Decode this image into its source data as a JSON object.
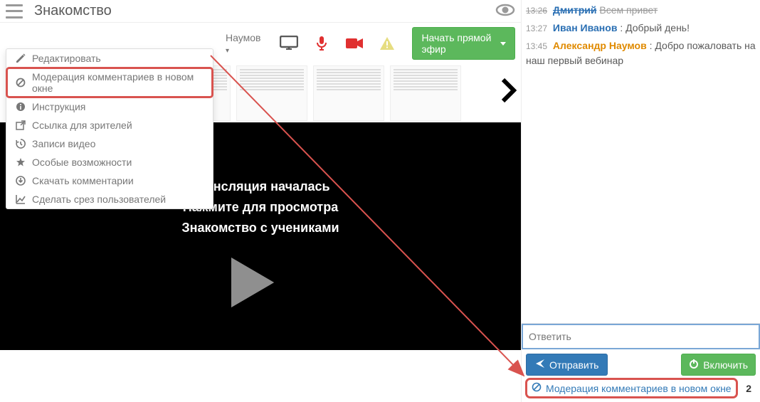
{
  "header": {
    "title": "Знакомство"
  },
  "toolbar": {
    "presenter_label": "Наумов",
    "start_button": "Начать прямой эфир"
  },
  "dropdown": {
    "items": [
      {
        "icon": "pencil",
        "label": "Редактировать"
      },
      {
        "icon": "ban",
        "label": "Модерация комментариев в новом окне",
        "highlighted": true
      },
      {
        "icon": "info",
        "label": "Инструкция"
      },
      {
        "icon": "share",
        "label": "Ссылка для зрителей"
      },
      {
        "icon": "history",
        "label": "Записи видео"
      },
      {
        "icon": "star",
        "label": "Особые возможности"
      },
      {
        "icon": "download",
        "label": "Скачать комментарии"
      },
      {
        "icon": "chart",
        "label": "Сделать срез пользователей"
      }
    ]
  },
  "stage": {
    "line1": "Трансляция началась",
    "line2": "Нажмите для просмотра",
    "line3": "Знакомство с учениками"
  },
  "chat": {
    "messages": [
      {
        "time": "13:26",
        "author": "Дмитрий",
        "author_color": "blue",
        "text": "Всем привет",
        "struck": true
      },
      {
        "time": "13:27",
        "author": "Иван Иванов",
        "author_color": "blue",
        "text": "Добрый день!"
      },
      {
        "time": "13:45",
        "author": "Александр Наумов",
        "author_color": "orange",
        "text": "Добро пожаловать на наш первый вебинар"
      }
    ],
    "reply_placeholder": "Ответить",
    "send_label": "Отправить",
    "enable_label": "Включить",
    "mod_link_label": "Модерация комментариев в новом окне",
    "mod_count": "2"
  }
}
